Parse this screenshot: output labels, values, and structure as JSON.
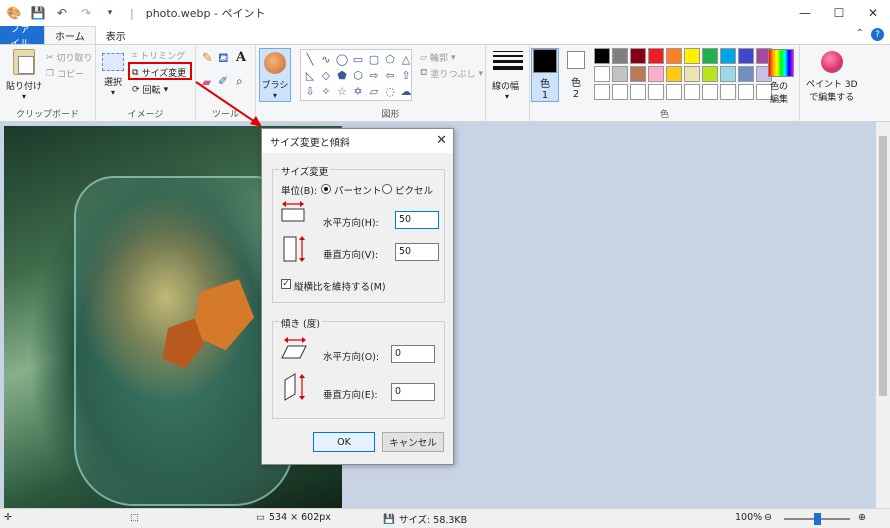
{
  "titlebar": {
    "title": "photo.webp - ペイント",
    "separator": "|",
    "min": "—",
    "max": "☐",
    "close": "✕"
  },
  "tabs": [
    {
      "label": "ファイル"
    },
    {
      "label": "ホーム"
    },
    {
      "label": "表示"
    }
  ],
  "ribbon": {
    "clipboard": {
      "label": "クリップボード",
      "paste": "貼り付け",
      "cut": "切り取り",
      "copy": "コピー"
    },
    "image": {
      "label": "イメージ",
      "select": "選択",
      "crop": "トリミング",
      "resize": "サイズ変更",
      "rotate": "回転"
    },
    "tools": {
      "label": "ツール"
    },
    "brush": {
      "label": "ブラシ"
    },
    "shapes": {
      "label": "図形",
      "outline": "輪郭",
      "fill": "塗りつぶし"
    },
    "line_width": {
      "label": "線の幅"
    },
    "colors": {
      "label": "色",
      "color1": "色\n1",
      "color1_a": "色",
      "color1_b": "1",
      "color2_a": "色",
      "color2_b": "2",
      "edit": "色の\n編集",
      "edit_a": "色の",
      "edit_b": "編集",
      "color1_hex": "#000000",
      "color2_hex": "#ffffff",
      "palette": [
        "#000000",
        "#7f7f7f",
        "#880015",
        "#ed1c24",
        "#ff7f27",
        "#fff200",
        "#22b14c",
        "#00a2e8",
        "#3f48cc",
        "#a349a4",
        "#ffffff",
        "#c3c3c3",
        "#b97a57",
        "#ffaec9",
        "#ffc90e",
        "#efe4b0",
        "#b5e61d",
        "#99d9ea",
        "#7092be",
        "#c8bfe7",
        "#ffffff",
        "#ffffff",
        "#ffffff",
        "#ffffff",
        "#ffffff",
        "#ffffff",
        "#ffffff",
        "#ffffff",
        "#ffffff",
        "#ffffff"
      ]
    },
    "paint3d": {
      "label_a": "ペイント 3D",
      "label_b": "で編集する"
    }
  },
  "dialog": {
    "title": "サイズ変更と傾斜",
    "resize_section": "サイズ変更",
    "unit_label": "単位(B):",
    "unit_percent": "パーセント",
    "unit_pixel": "ピクセル",
    "horizontal_label": "水平方向(H):",
    "horizontal_value": "50",
    "vertical_label": "垂直方向(V):",
    "vertical_value": "50",
    "keep_aspect": "縦横比を維持する(M)",
    "skew_section": "傾き (度)",
    "skew_h_label": "水平方向(O):",
    "skew_h_value": "0",
    "skew_v_label": "垂直方向(E):",
    "skew_v_value": "0",
    "ok": "OK",
    "cancel": "キャンセル"
  },
  "status": {
    "dimensions": "534 × 602px",
    "size": "サイズ: 58.3KB",
    "zoom": "100%"
  }
}
